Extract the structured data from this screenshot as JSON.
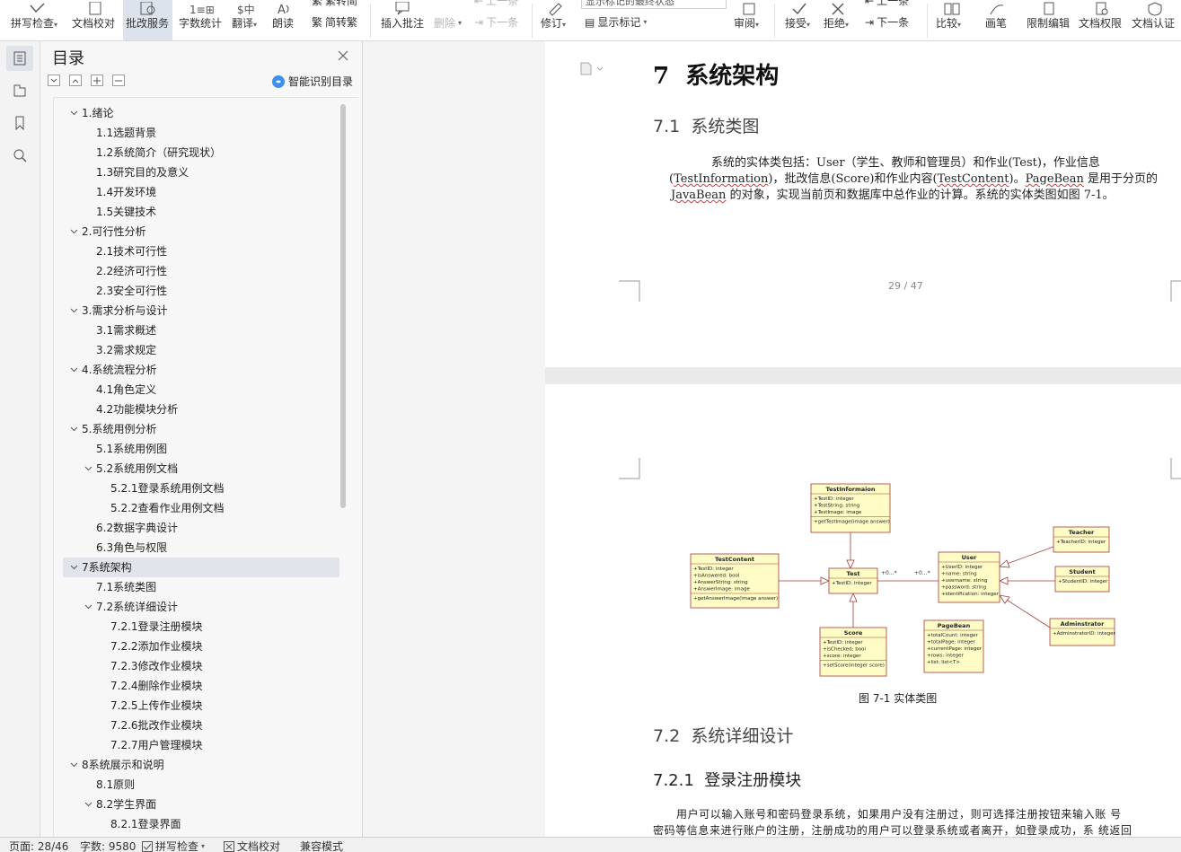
{
  "ribbon": {
    "buttons": [
      {
        "label": "拼写检查",
        "caret": "▾"
      },
      {
        "label": "文档校对"
      },
      {
        "label": "批改服务"
      },
      {
        "label": "字数统计"
      },
      {
        "label": "翻译",
        "caret": "▾"
      },
      {
        "label": "朗读"
      },
      {
        "label": "插入批注"
      },
      {
        "label": "修订",
        "caret": "▾"
      },
      {
        "label": "审阅",
        "caret": "▾"
      },
      {
        "label": "接受",
        "caret": "▾"
      },
      {
        "label": "拒绝",
        "caret": "▾"
      },
      {
        "label": "比较",
        "caret": "▾"
      },
      {
        "label": "画笔"
      },
      {
        "label": "限制编辑"
      },
      {
        "label": "文档权限"
      },
      {
        "label": "文档认证"
      }
    ],
    "small": {
      "simp_trad": "繁转简",
      "trad_simp": "简转繁",
      "delete": "删除",
      "prev": "上一条",
      "next_disabled": "下一条",
      "show_marks": "显示标记",
      "prev2": "上一条",
      "next2": "下一条"
    },
    "dropdown_value": "显示标记的最终状态"
  },
  "toc": {
    "title": "目录",
    "smart_label": "智能识别目录",
    "items": [
      {
        "label": "1.绪论",
        "level": 1,
        "toggle": "open"
      },
      {
        "label": "1.1选题背景",
        "level": 2
      },
      {
        "label": "1.2系统简介（研究现状）",
        "level": 2
      },
      {
        "label": "1.3研究目的及意义",
        "level": 2
      },
      {
        "label": "1.4开发环境",
        "level": 2
      },
      {
        "label": "1.5关键技术",
        "level": 2
      },
      {
        "label": "2.可行性分析",
        "level": 1,
        "toggle": "open"
      },
      {
        "label": "2.1技术可行性",
        "level": 2
      },
      {
        "label": "2.2经济可行性",
        "level": 2
      },
      {
        "label": "2.3安全可行性",
        "level": 2
      },
      {
        "label": "3.需求分析与设计",
        "level": 1,
        "toggle": "open"
      },
      {
        "label": "3.1需求概述",
        "level": 2
      },
      {
        "label": "3.2需求规定",
        "level": 2
      },
      {
        "label": "4.系统流程分析",
        "level": 1,
        "toggle": "open"
      },
      {
        "label": "4.1角色定义",
        "level": 2
      },
      {
        "label": "4.2功能模块分析",
        "level": 2
      },
      {
        "label": "5.系统用例分析",
        "level": 1,
        "toggle": "open"
      },
      {
        "label": "5.1系统用例图",
        "level": 2
      },
      {
        "label": "5.2系统用例文档",
        "level": 2,
        "toggle": "open"
      },
      {
        "label": "5.2.1登录系统用例文档",
        "level": 3
      },
      {
        "label": "5.2.2查看作业用例文档",
        "level": 3
      },
      {
        "label": "6.2数据字典设计",
        "level": 2
      },
      {
        "label": "6.3角色与权限",
        "level": 2
      },
      {
        "label": "7系统架构",
        "level": 1,
        "toggle": "open",
        "selected": true
      },
      {
        "label": "7.1系统类图",
        "level": 2
      },
      {
        "label": "7.2系统详细设计",
        "level": 2,
        "toggle": "open"
      },
      {
        "label": "7.2.1登录注册模块",
        "level": 3
      },
      {
        "label": "7.2.2添加作业模块",
        "level": 3
      },
      {
        "label": "7.2.3修改作业模块",
        "level": 3
      },
      {
        "label": "7.2.4删除作业模块",
        "level": 3
      },
      {
        "label": "7.2.5上传作业模块",
        "level": 3
      },
      {
        "label": "7.2.6批改作业模块",
        "level": 3
      },
      {
        "label": "7.2.7用户管理模块",
        "level": 3
      },
      {
        "label": "8系统展示和说明",
        "level": 1,
        "toggle": "open"
      },
      {
        "label": "8.1原则",
        "level": 2
      },
      {
        "label": "8.2学生界面",
        "level": 2,
        "toggle": "open"
      },
      {
        "label": "8.2.1登录界面",
        "level": 3
      }
    ]
  },
  "doc": {
    "page1": {
      "h1_num": "7",
      "h1_text": "系统架构",
      "h2_num": "7.1",
      "h2_text": "系统类图",
      "para_line1": "系统的实体类包括：User（学生、教师和管理员）和作业(Test)，作业信息",
      "para_line2_a": "(",
      "para_line2_w1": "TestInformation",
      "para_line2_b": ")，批改信息(Score)和作业内容(",
      "para_line2_w2": "TestContent",
      "para_line2_c": ")。",
      "para_line2_w3": "PageBean",
      "para_line2_d": " 是用于分页的",
      "para_line3_w": "JavaBean",
      "para_line3_rest": " 的对象，实现当前页和数据库中总作业的计算。系统的实体类图如图 7-1。",
      "page_number": "29 / 47"
    },
    "page2": {
      "caption": "图 7-1 实体类图",
      "h2_num": "7.2",
      "h2_text": "系统详细设计",
      "h3_num": "7.2.1",
      "h3_text": "登录注册模块",
      "para_line1": "用户可以输入账号和密码登录系统，如果用户没有注册过，则可选择注册按钮来输入账   号",
      "para_line2": "密码等信息来进行账户的注册，注册成功的用户可以登录系统或者离开，如登录成功，系   统返回"
    },
    "uml": {
      "classes": [
        {
          "name": "TestInformaion",
          "attrs": [
            "+TestID: integer",
            "+TestString: string",
            "+TestImage: image"
          ],
          "ops": [
            "+getTestImage(image answer)"
          ]
        },
        {
          "name": "TestContent",
          "attrs": [
            "+TestID: integer",
            "+isAnswered: bool",
            "+AnswerString: string",
            "+AnswerImage: image"
          ],
          "ops": [
            "+getAnswerImage(image answer)"
          ]
        },
        {
          "name": "Test",
          "attrs": [
            "+TestID: integer"
          ],
          "ops": []
        },
        {
          "name": "User",
          "attrs": [
            "+UserID: integer",
            "+name: string",
            "+username: string",
            "+password: string",
            "+identification: integer"
          ],
          "ops": []
        },
        {
          "name": "Teacher",
          "attrs": [
            "+TeacherID: integer"
          ],
          "ops": []
        },
        {
          "name": "Student",
          "attrs": [
            "+StudentID: integer"
          ],
          "ops": []
        },
        {
          "name": "Adminstrator",
          "attrs": [
            "+AdminstratorID: integer"
          ],
          "ops": []
        },
        {
          "name": "Score",
          "attrs": [
            "+TestID: integer",
            "+isChecked: bool",
            "+score: integer"
          ],
          "ops": [
            "+setScore(integer score)"
          ]
        },
        {
          "name": "PageBean",
          "attrs": [
            "+totalCount: integer",
            "+totalPage: integer",
            "+currentPage: integer",
            "+rows: integer",
            "+list: list<T>"
          ],
          "ops": []
        }
      ],
      "mult_left": "+0...*",
      "mult_right": "+0...*",
      "fill": "#fffcc6",
      "stroke": "#a33a3a"
    }
  },
  "status": {
    "page": "页面: 28/46",
    "words": "字数: 9580",
    "spell": "拼写检查",
    "proof": "文档校对",
    "compat": "兼容模式"
  },
  "colors": {
    "ribbon_active": "#dde3ec",
    "toc_selected": "#e1e4ea",
    "accent_blue": "#3d8ff0",
    "wavy_underline": "#d33333"
  }
}
